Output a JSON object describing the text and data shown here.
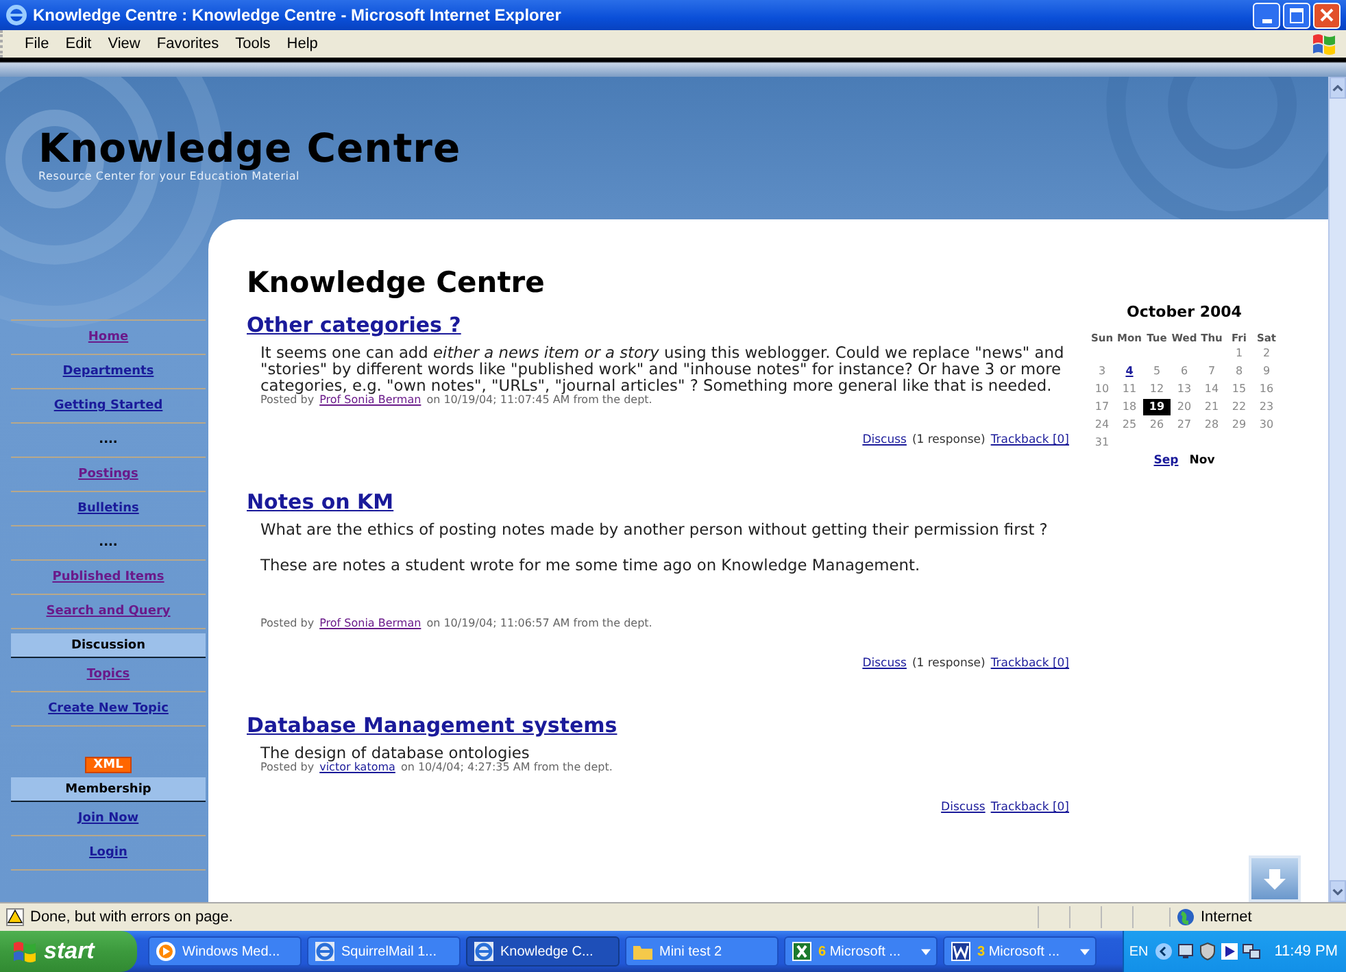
{
  "window": {
    "title": "Knowledge Centre : Knowledge Centre - Microsoft Internet Explorer"
  },
  "menu": [
    "File",
    "Edit",
    "View",
    "Favorites",
    "Tools",
    "Help"
  ],
  "site": {
    "title": "Knowledge Centre",
    "tagline": "Resource Center for your Education Material"
  },
  "sidebar": {
    "items": [
      {
        "kind": "link",
        "label": "Home",
        "visited": true
      },
      {
        "kind": "link",
        "label": "Departments",
        "visited": false
      },
      {
        "kind": "link",
        "label": "Getting Started",
        "visited": false
      },
      {
        "kind": "dots",
        "label": "...."
      },
      {
        "kind": "link",
        "label": "Postings",
        "visited": true
      },
      {
        "kind": "link",
        "label": "Bulletins",
        "visited": false
      },
      {
        "kind": "dots",
        "label": "...."
      },
      {
        "kind": "link",
        "label": "Published Items",
        "visited": true
      },
      {
        "kind": "link",
        "label": "Search and Query",
        "visited": true
      },
      {
        "kind": "section",
        "label": "Discussion"
      },
      {
        "kind": "link",
        "label": "Topics",
        "visited": true
      },
      {
        "kind": "link",
        "label": "Create New Topic",
        "visited": false
      },
      {
        "kind": "badge",
        "label": "XML"
      },
      {
        "kind": "section",
        "label": "Membership"
      },
      {
        "kind": "link",
        "label": "Join Now",
        "visited": false
      },
      {
        "kind": "link",
        "label": "Login",
        "visited": false
      }
    ]
  },
  "page_heading": "Knowledge Centre",
  "posts": [
    {
      "title": "Other categories ?",
      "paragraphs": [
        "It seems one can add *either a news item or a story* using this weblogger.  Could we replace \"news\" and \"stories\" by different words like \"published work\" and \"inhouse notes\" for instance?  Or have 3 or more categories, e.g. \"own notes\", \"URLs\", \"journal articles\" ?  Something more general like that is needed."
      ],
      "posted_by": "Posted by",
      "author": "Prof Sonia Berman",
      "author_visited": true,
      "posted_on": "on 10/19/04; 11:07:45 AM from the dept.",
      "discuss": "Discuss",
      "responses": "(1 response)",
      "trackback": "Trackback [0]"
    },
    {
      "title": "Notes on KM",
      "paragraphs": [
        "What are the ethics of posting notes made by another person without getting their permission first ?",
        "These are notes a student wrote for me some time ago on Knowledge Management."
      ],
      "posted_by": "Posted by",
      "author": "Prof Sonia Berman",
      "author_visited": true,
      "posted_on": "on 10/19/04; 11:06:57 AM from the dept.",
      "discuss": "Discuss",
      "responses": "(1 response)",
      "trackback": "Trackback [0]"
    },
    {
      "title": "Database Management systems",
      "paragraphs": [
        "The design of database ontologies"
      ],
      "posted_by": "Posted by",
      "author": "victor katoma",
      "author_visited": false,
      "posted_on": "on 10/4/04; 4:27:35 AM from the dept.",
      "discuss": "Discuss",
      "trackback": "Trackback [0]"
    }
  ],
  "calendar": {
    "title": "October 2004",
    "weekdays": [
      "Sun",
      "Mon",
      "Tue",
      "Wed",
      "Thu",
      "Fri",
      "Sat"
    ],
    "weeks": [
      {
        "kind": "tail",
        "days": [
          {
            "text": "1",
            "link": false,
            "selected": false
          },
          {
            "text": "2",
            "link": false,
            "selected": false
          }
        ]
      },
      {
        "kind": "full",
        "days": [
          {
            "text": "3",
            "link": false,
            "selected": false
          },
          {
            "text": "4",
            "link": true,
            "selected": false
          },
          {
            "text": "5",
            "link": false,
            "selected": false
          },
          {
            "text": "6",
            "link": false,
            "selected": false
          },
          {
            "text": "7",
            "link": false,
            "selected": false
          },
          {
            "text": "8",
            "link": false,
            "selected": false
          },
          {
            "text": "9",
            "link": false,
            "selected": false
          }
        ]
      },
      {
        "kind": "full",
        "days": [
          {
            "text": "10",
            "link": false,
            "selected": false
          },
          {
            "text": "11",
            "link": false,
            "selected": false
          },
          {
            "text": "12",
            "link": false,
            "selected": false
          },
          {
            "text": "13",
            "link": false,
            "selected": false
          },
          {
            "text": "14",
            "link": false,
            "selected": false
          },
          {
            "text": "15",
            "link": false,
            "selected": false
          },
          {
            "text": "16",
            "link": false,
            "selected": false
          }
        ]
      },
      {
        "kind": "full",
        "days": [
          {
            "text": "17",
            "link": false,
            "selected": false
          },
          {
            "text": "18",
            "link": false,
            "selected": false
          },
          {
            "text": "19",
            "link": false,
            "selected": true
          },
          {
            "text": "20",
            "link": false,
            "selected": false
          },
          {
            "text": "21",
            "link": false,
            "selected": false
          },
          {
            "text": "22",
            "link": false,
            "selected": false
          },
          {
            "text": "23",
            "link": false,
            "selected": false
          }
        ]
      },
      {
        "kind": "full",
        "days": [
          {
            "text": "24",
            "link": false,
            "selected": false
          },
          {
            "text": "25",
            "link": false,
            "selected": false
          },
          {
            "text": "26",
            "link": false,
            "selected": false
          },
          {
            "text": "27",
            "link": false,
            "selected": false
          },
          {
            "text": "28",
            "link": false,
            "selected": false
          },
          {
            "text": "29",
            "link": false,
            "selected": false
          },
          {
            "text": "30",
            "link": false,
            "selected": false
          }
        ]
      },
      {
        "kind": "full",
        "days": [
          {
            "text": "31",
            "link": false,
            "selected": false
          }
        ]
      }
    ],
    "prev": "Sep",
    "next": "Nov"
  },
  "status_bar": {
    "message": "Done, but with errors on page.",
    "zone": "Internet"
  },
  "taskbar": {
    "start": "start",
    "tasks": [
      {
        "kind": "media",
        "label": "Windows Med...",
        "selected": false,
        "menu": false
      },
      {
        "kind": "browser",
        "label": "SquirrelMail 1...",
        "selected": false,
        "menu": false
      },
      {
        "kind": "browser",
        "label": "Knowledge C...",
        "selected": true,
        "menu": false
      },
      {
        "kind": "folder",
        "label": "Mini test 2",
        "selected": false,
        "menu": false
      },
      {
        "kind": "sheet",
        "label": "**6** Microsoft ...",
        "selected": false,
        "menu": true
      },
      {
        "kind": "doc",
        "label": "**3** Microsoft ...",
        "selected": false,
        "menu": true
      }
    ],
    "language": "EN",
    "clock": "11:49 PM"
  }
}
